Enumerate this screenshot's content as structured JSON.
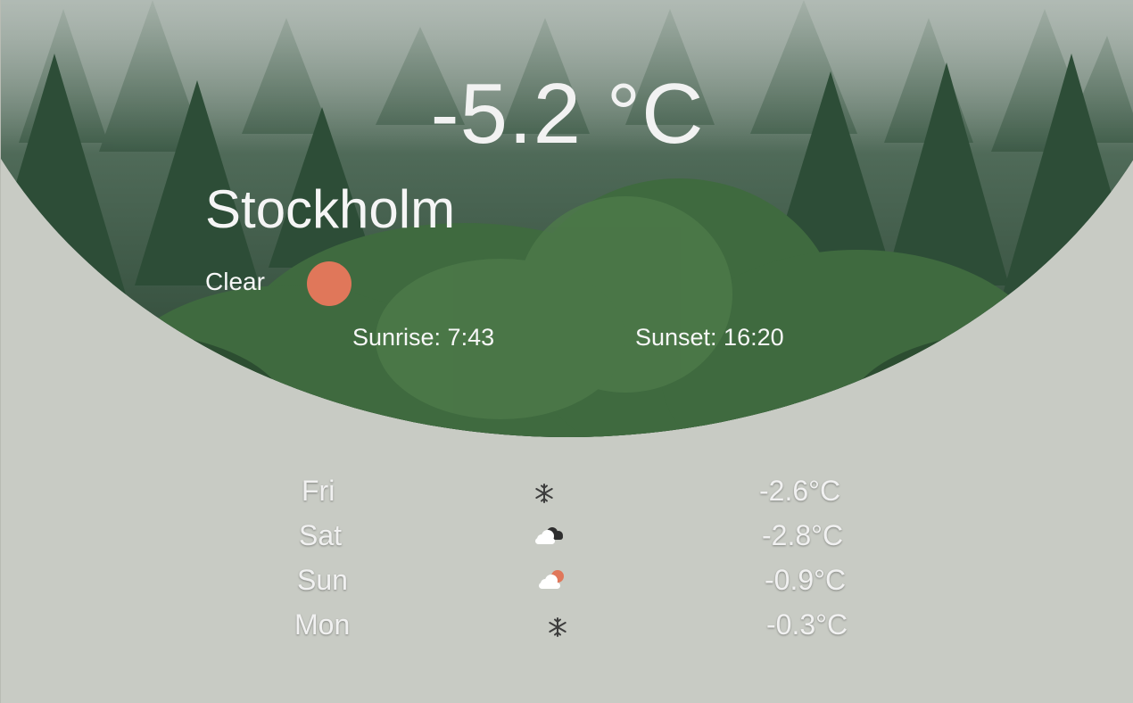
{
  "current": {
    "temperature": "-5.2 °C",
    "city": "Stockholm",
    "condition": "Clear",
    "condition_icon": "sun-icon",
    "sunrise": "Sunrise: 7:43",
    "sunset": "Sunset: 16:20"
  },
  "forecast": [
    {
      "day": "Fri",
      "icon": "snowflake-icon",
      "temp": "-2.6°C"
    },
    {
      "day": "Sat",
      "icon": "cloudy-icon",
      "temp": "-2.8°C"
    },
    {
      "day": "Sun",
      "icon": "partly-cloudy-icon",
      "temp": "-0.9°C"
    },
    {
      "day": "Mon",
      "icon": "snowflake-icon",
      "temp": "-0.3°C"
    }
  ],
  "colors": {
    "background": "#c8cbc4",
    "sun": "#e0775a",
    "text": "#f5f5f5"
  }
}
